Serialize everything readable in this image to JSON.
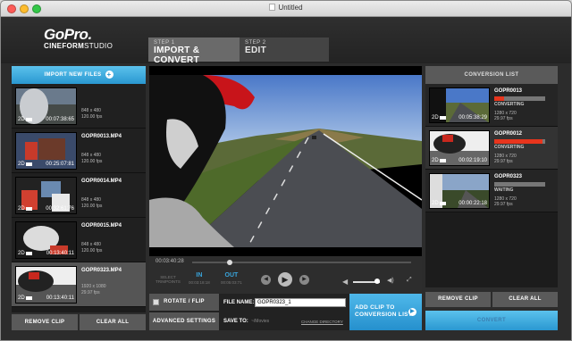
{
  "window": {
    "title": "Untitled"
  },
  "app": {
    "logo_main": "GoPro.",
    "logo_sub_bold": "CINEFORM",
    "logo_sub_light": "STUDIO"
  },
  "steps": [
    {
      "num": "STEP 1",
      "label": "IMPORT & CONVERT"
    },
    {
      "num": "STEP 2",
      "label": "EDIT"
    }
  ],
  "import_panel": {
    "import_label": "IMPORT NEW FILES",
    "clips": [
      {
        "name": "",
        "tag": "2D",
        "duration": "00:07:38:65",
        "meta": [
          "848 x 480",
          "120.00 fps"
        ]
      },
      {
        "name": "GOPR0013.MP4",
        "tag": "2D",
        "duration": "00:25:07:81",
        "meta": [
          "848 x 480",
          "120.00 fps"
        ]
      },
      {
        "name": "GOPR0014.MP4",
        "tag": "2D",
        "duration": "00:32:61:76",
        "meta": [
          "848 x 480",
          "120.00 fps"
        ]
      },
      {
        "name": "GOPR0015.MP4",
        "tag": "2D",
        "duration": "00:13:40:11",
        "meta": [
          "848 x 480",
          "120.00 fps"
        ]
      },
      {
        "name": "GOPR0323.MP4",
        "tag": "2D",
        "duration": "00:13:40:11",
        "meta": [
          "1920 x 1080",
          "29.97 fps"
        ]
      }
    ],
    "remove_label": "REMOVE CLIP",
    "clear_label": "CLEAR ALL"
  },
  "player": {
    "timecode": "00:03:40:28",
    "progress": 0.16,
    "select_trimpoints": "SELECT TRIMPOINTS",
    "in_label": "IN",
    "in_tc": "00:03:18:18",
    "out_label": "OUT",
    "out_tc": "00:05:03:71",
    "volume": 0.9
  },
  "options": {
    "rotate_label": "ROTATE / FLIP",
    "advanced_label": "ADVANCED SETTINGS",
    "file_name_label": "FILE NAME:",
    "file_name_value": "GOPR0323_1",
    "save_to_label": "SAVE TO:",
    "save_to_value": "~/Movies",
    "change_dir_label": "CHANGE DIRECTORY",
    "add_clip_label_1": "ADD CLIP TO",
    "add_clip_label_2": "CONVERSION LIST"
  },
  "conversion": {
    "header": "CONVERSION LIST",
    "items": [
      {
        "name": "GOPR0013",
        "tag": "2D",
        "duration": "00:05:38:29",
        "progress": 0.2,
        "status": "CONVERTING",
        "meta": [
          "1280 x 720",
          "29.97 fps"
        ]
      },
      {
        "name": "GOPR0012",
        "tag": "2D",
        "duration": "00:02:19:10",
        "progress": 0.95,
        "status": "CONVERTING",
        "meta": [
          "1280 x 720",
          "29.97 fps"
        ]
      },
      {
        "name": "GOPR0323",
        "tag": "2D",
        "duration": "00:00:22:18",
        "progress": 0,
        "status": "WAITING",
        "meta": [
          "1280 x 720",
          "29.97 fps"
        ]
      }
    ],
    "remove_label": "REMOVE CLIP",
    "clear_label": "CLEAR ALL",
    "convert_label": "CONVERT"
  },
  "colors": {
    "accent": "#2a98d1",
    "progress": "#e8351d"
  }
}
